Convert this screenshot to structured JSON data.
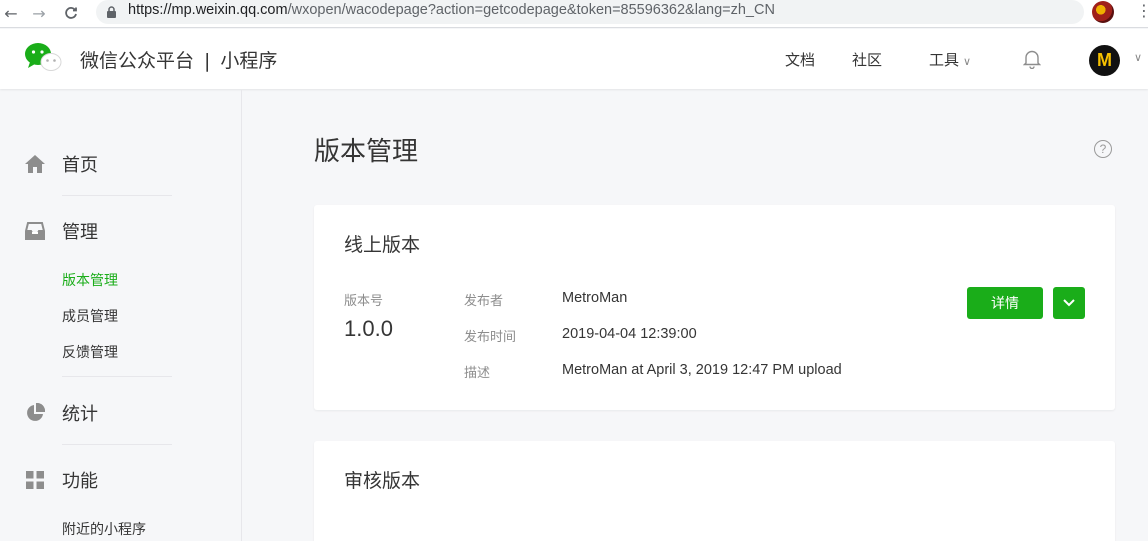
{
  "browser": {
    "back": "←",
    "forward": "→",
    "reload": "C",
    "url_host": "https://mp.weixin.qq.com",
    "url_rest": "/wxopen/wacodepage?action=getcodepage&token=85596362&lang=zh_CN",
    "star": "☆",
    "menu": "⋮"
  },
  "header": {
    "brand_left": "微信公众平台",
    "brand_sep": "|",
    "brand_right": "小程序",
    "nav_docs": "文档",
    "nav_community": "社区",
    "nav_tools": "工具",
    "avatar_letter": "M"
  },
  "sidebar": {
    "home": "首页",
    "manage": "管理",
    "manage_items": [
      "版本管理",
      "成员管理",
      "反馈管理"
    ],
    "stats": "统计",
    "features": "功能",
    "features_items": [
      "附近的小程序"
    ]
  },
  "main": {
    "title": "版本管理",
    "help": "?",
    "online_card": {
      "title": "线上版本",
      "version_label": "版本号",
      "version": "1.0.0",
      "publisher_label": "发布者",
      "publisher": "MetroMan",
      "time_label": "发布时间",
      "time": "2019-04-04 12:39:00",
      "desc_label": "描述",
      "desc": "MetroMan at April 3, 2019 12:47 PM upload",
      "detail_button": "详情"
    },
    "review_card": {
      "title": "审核版本"
    }
  },
  "colors": {
    "accent": "#1aad19"
  },
  "icons": [
    "lock-icon",
    "star-icon",
    "wechat-logo-icon",
    "bell-icon",
    "home-icon",
    "inbox-icon",
    "pie-chart-icon",
    "grid-icon",
    "help-icon",
    "chevron-down-icon"
  ]
}
